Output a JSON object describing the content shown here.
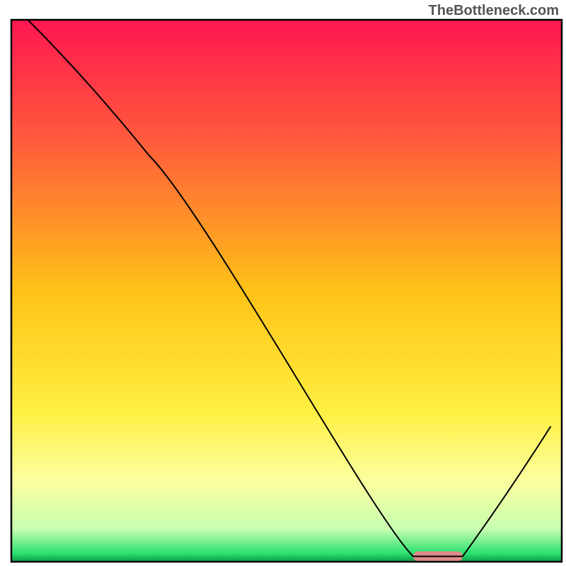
{
  "watermark": "TheBottleneck.com",
  "chart_data": {
    "type": "line",
    "title": "",
    "xlabel": "",
    "ylabel": "",
    "xlim": [
      0,
      100
    ],
    "ylim": [
      0,
      100
    ],
    "series": [
      {
        "name": "curve",
        "x": [
          3,
          25,
          73,
          82,
          98
        ],
        "y": [
          100,
          75,
          1,
          1,
          25
        ],
        "note": "Piecewise curve: steep descent from top-left, kink near x=25, near-linear descent to trough flat segment around x=73-82, then rise to x=98."
      }
    ],
    "background_gradient": {
      "stops": [
        {
          "offset": 0.0,
          "color": "#ff1750"
        },
        {
          "offset": 0.22,
          "color": "#ff5a3c"
        },
        {
          "offset": 0.5,
          "color": "#ffc217"
        },
        {
          "offset": 0.72,
          "color": "#ffef40"
        },
        {
          "offset": 0.85,
          "color": "#fbff9e"
        },
        {
          "offset": 0.94,
          "color": "#c7ffb0"
        },
        {
          "offset": 0.985,
          "color": "#29e06f"
        },
        {
          "offset": 1.0,
          "color": "#0a9a4a"
        }
      ]
    },
    "marker": {
      "x_start": 73,
      "x_end": 82,
      "y": 1,
      "color": "#e28a8a",
      "thickness": 14
    },
    "frame": {
      "stroke": "#000000",
      "width": 2.5
    },
    "curve_style": {
      "stroke": "#000000",
      "width": 2
    }
  }
}
